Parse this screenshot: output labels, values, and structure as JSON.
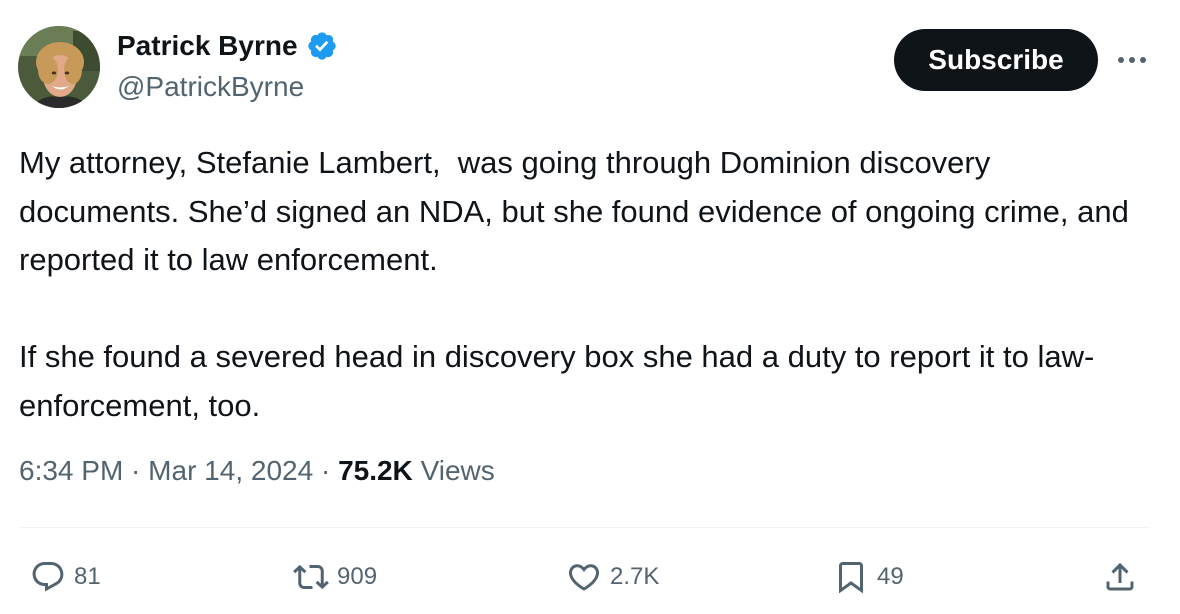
{
  "author": {
    "display_name": "Patrick Byrne",
    "handle": "@PatrickByrne",
    "verified": true,
    "verified_color": "#1d9bf0"
  },
  "header": {
    "subscribe_label": "Subscribe",
    "more_icon": "more-horizontal-icon"
  },
  "tweet": {
    "paragraphs": [
      "My attorney, Stefanie Lambert,  was going through Dominion discovery documents. She’d signed an NDA, but she found evidence of ongoing crime, and reported it to law enforcement.",
      "If she found a severed head in discovery box she had a duty to report it to law-enforcement, too."
    ]
  },
  "meta": {
    "time": "6:34 PM",
    "separator": " · ",
    "date": "Mar 14, 2024",
    "views_count": "75.2K",
    "views_label": "Views"
  },
  "actions": {
    "replies": "81",
    "reposts": "909",
    "likes": "2.7K",
    "bookmarks": "49",
    "icons": [
      "reply-icon",
      "repost-icon",
      "like-icon",
      "bookmark-icon",
      "share-icon"
    ]
  },
  "colors": {
    "text_primary": "#0f1419",
    "text_secondary": "#536471",
    "button_bg": "#0f1419",
    "divider": "#eff3f4"
  }
}
